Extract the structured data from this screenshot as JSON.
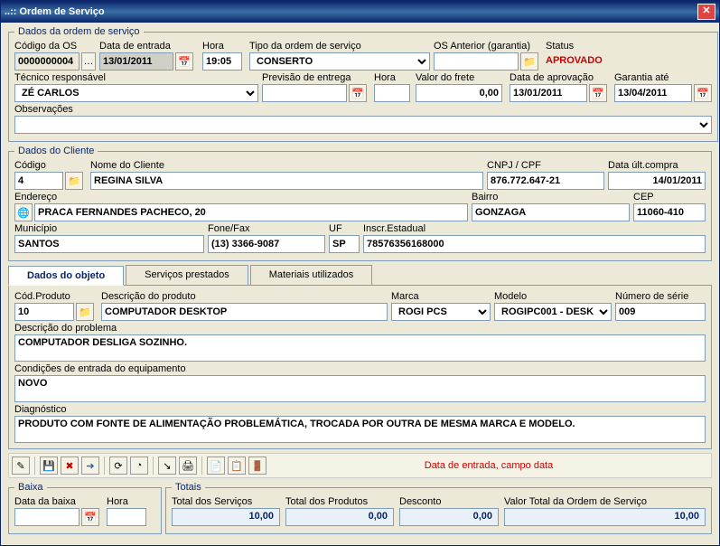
{
  "window": {
    "title": "..:: Ordem de Serviço"
  },
  "serviceOrder": {
    "legend": "Dados da ordem de serviço",
    "codigo_lbl": "Código da OS",
    "codigo": "0000000004",
    "data_entrada_lbl": "Data de entrada",
    "data_entrada": "13/01/2011",
    "hora_lbl": "Hora",
    "hora": "19:05",
    "tipo_lbl": "Tipo da ordem de serviço",
    "tipo": "CONSERTO",
    "os_anterior_lbl": "OS Anterior (garantia)",
    "os_anterior": "",
    "status_lbl": "Status",
    "status": "APROVADO",
    "tecnico_lbl": "Técnico responsável",
    "tecnico": "ZÉ CARLOS",
    "previsao_lbl": "Previsão de entrega",
    "previsao": "",
    "hora2_lbl": "Hora",
    "hora2": "",
    "frete_lbl": "Valor do frete",
    "frete": "0,00",
    "data_aprov_lbl": "Data de aprovação",
    "data_aprov": "13/01/2011",
    "garantia_lbl": "Garantia até",
    "garantia": "13/04/2011",
    "obs_lbl": "Observações",
    "obs": ""
  },
  "cliente": {
    "legend": "Dados do Cliente",
    "codigo_lbl": "Código",
    "codigo": "4",
    "nome_lbl": "Nome do Cliente",
    "nome": "REGINA SILVA",
    "cnpj_lbl": "CNPJ / CPF",
    "cnpj": "876.772.647-21",
    "data_compra_lbl": "Data últ.compra",
    "data_compra": "14/01/2011",
    "endereco_lbl": "Endereço",
    "endereco": "PRACA FERNANDES PACHECO, 20",
    "bairro_lbl": "Bairro",
    "bairro": "GONZAGA",
    "cep_lbl": "CEP",
    "cep": "11060-410",
    "municipio_lbl": "Município",
    "municipio": "SANTOS",
    "fone_lbl": "Fone/Fax",
    "fone": "(13) 3366-9087",
    "uf_lbl": "UF",
    "uf": "SP",
    "inscr_lbl": "Inscr.Estadual",
    "inscr": "78576356168000"
  },
  "tabs": {
    "t1": "Dados do objeto",
    "t2": "Serviços prestados",
    "t3": "Materiais utilizados"
  },
  "objeto": {
    "cod_lbl": "Cód.Produto",
    "cod": "10",
    "desc_lbl": "Descrição do produto",
    "desc": "COMPUTADOR DESKTOP",
    "marca_lbl": "Marca",
    "marca": "ROGI PCS",
    "modelo_lbl": "Modelo",
    "modelo": "ROGIPC001 - DESK",
    "serie_lbl": "Número de série",
    "serie": "009",
    "problema_lbl": "Descrição do problema",
    "problema": "COMPUTADOR DESLIGA SOZINHO.",
    "cond_lbl": "Condições de entrada do equipamento",
    "cond": "NOVO",
    "diag_lbl": "Diagnóstico",
    "diag": "PRODUTO COM FONTE DE ALIMENTAÇÃO PROBLEMÁTICA, TROCADA POR OUTRA DE MESMA MARCA E MODELO."
  },
  "toolbar": {
    "msg": "Data de entrada, campo data"
  },
  "baixa": {
    "legend": "Baixa",
    "data_lbl": "Data da baixa",
    "data": "",
    "hora_lbl": "Hora",
    "hora": ""
  },
  "totais": {
    "legend": "Totais",
    "serv_lbl": "Total dos Serviços",
    "serv": "10,00",
    "prod_lbl": "Total dos Produtos",
    "prod": "0,00",
    "desc_lbl": "Desconto",
    "desc": "0,00",
    "total_lbl": "Valor Total da Ordem de Serviço",
    "total": "10,00"
  }
}
